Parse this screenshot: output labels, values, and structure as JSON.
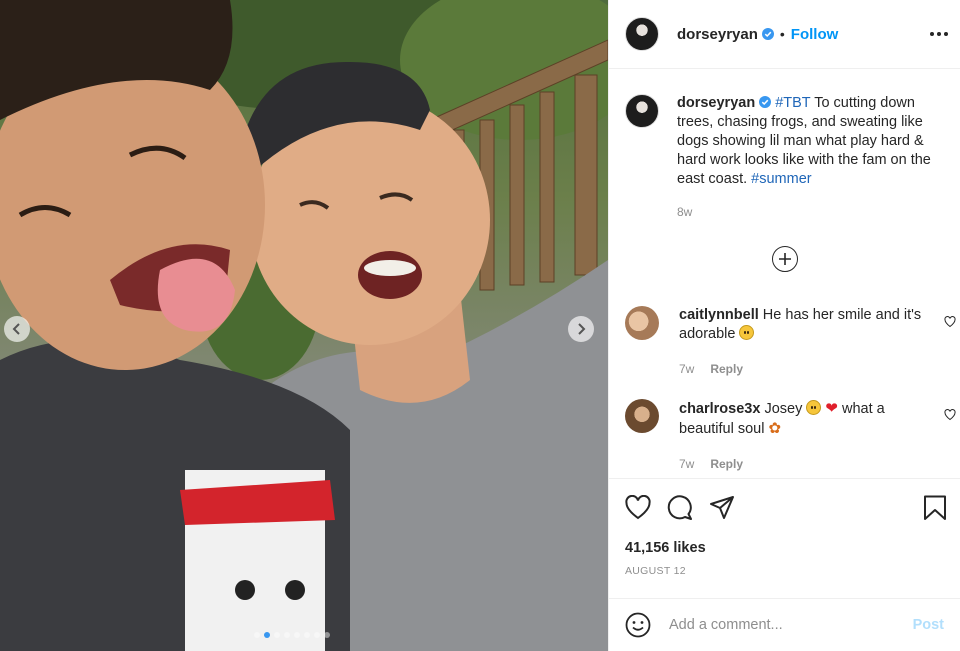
{
  "post": {
    "username": "dorseyryan",
    "follow_label": "Follow",
    "separator": "•",
    "caption": {
      "hashtag_tbt": "#TBT",
      "text": " To cutting down trees, chasing frogs, and sweating like dogs showing lil man what play hard & hard work looks like with the fam on the east coast. ",
      "hashtag_summer": "#summer",
      "time": "8w"
    },
    "likes": "41,156 likes",
    "date": "AUGUST 12"
  },
  "comments": [
    {
      "username": "caitlynnbell",
      "text_before": " He has her smile and it's adorable ",
      "text_after": "",
      "time": "7w",
      "reply_label": "Reply"
    },
    {
      "username": "charlrose3x",
      "text_before": " Josey ",
      "text_after": " what a beautiful soul ",
      "time": "7w",
      "reply_label": "Reply"
    }
  ],
  "add_comment": {
    "placeholder": "Add a comment...",
    "post_label": "Post"
  },
  "icons": {
    "verified": "verified-badge-icon",
    "more": "more-options-icon",
    "like": "heart-icon",
    "comment": "comment-icon",
    "share": "share-icon",
    "save": "bookmark-icon",
    "emoji": "emoji-icon",
    "load_more": "plus-circle-icon",
    "prev": "chevron-left-icon",
    "next": "chevron-right-icon"
  },
  "colors": {
    "accent": "#0095f6",
    "verified": "#3897f0",
    "post_disabled": "#b2dffc",
    "hashtag": "#1f66b8"
  }
}
